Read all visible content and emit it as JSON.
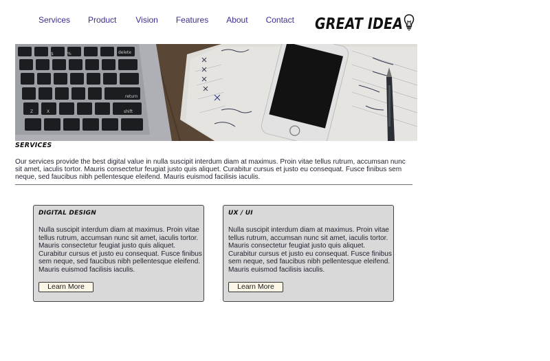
{
  "nav": {
    "items": [
      {
        "label": "Services"
      },
      {
        "label": "Product"
      },
      {
        "label": "Vision"
      },
      {
        "label": "Features"
      },
      {
        "label": "About"
      },
      {
        "label": "Contact"
      }
    ]
  },
  "logo": {
    "text": "GREAT IDEA",
    "icon": "lightbulb-icon"
  },
  "hero": {
    "image": "desk-with-laptop-keyboard-phone-notebook-pen"
  },
  "services": {
    "title": "Services",
    "intro": "Our services provide the best digital value in nulla suscipit interdum diam at maximus. Proin vitae tellus rutrum, accumsan nunc sit amet, iaculis tortor. Mauris consectetur feugiat justo quis aliquet. Curabitur cursus et justo eu consequat. Fusce finibus sem neque, sed faucibus nibh pellentesque eleifend. Mauris euismod facilisis iaculis."
  },
  "cards": [
    {
      "title": "Digital Design",
      "text": "Nulla suscipit interdum diam at maximus. Proin vitae tellus rutrum, accumsan nunc sit amet, iaculis tortor. Mauris consectetur feugiat justo quis aliquet. Curabitur cursus et justo eu consequat. Fusce finibus sem neque, sed faucibus nibh pellentesque eleifend. Mauris euismod facilisis iaculis.",
      "button": "Learn More"
    },
    {
      "title": "UX / UI",
      "text": "Nulla suscipit interdum diam at maximus. Proin vitae tellus rutrum, accumsan nunc sit amet, iaculis tortor. Mauris consectetur feugiat justo quis aliquet. Curabitur cursus et justo eu consequat. Fusce finibus sem neque, sed faucibus nibh pellentesque eleifend. Mauris euismod facilisis iaculis.",
      "button": "Learn More"
    }
  ],
  "colors": {
    "nav_link": "#3a2f8f",
    "card_bg": "#d9d9d9",
    "button_bg": "#fbf6e6"
  }
}
